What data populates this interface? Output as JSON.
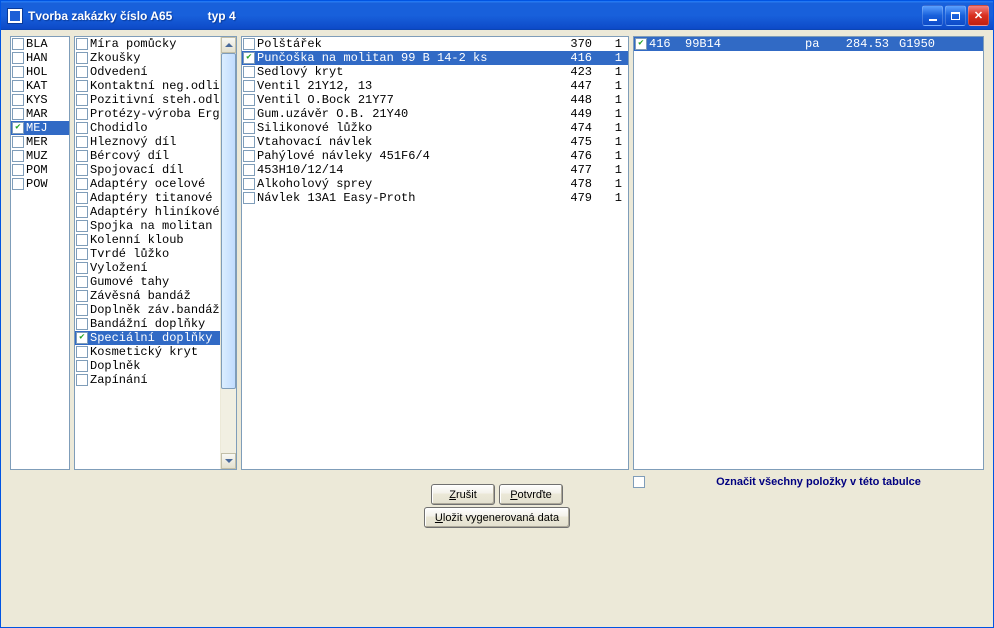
{
  "window": {
    "title_main": "Tvorba zakázky číslo A65",
    "title_typ": "typ 4"
  },
  "list1": {
    "items": [
      {
        "label": "BLA",
        "checked": false,
        "selected": false
      },
      {
        "label": "HAN",
        "checked": false,
        "selected": false
      },
      {
        "label": "HOL",
        "checked": false,
        "selected": false
      },
      {
        "label": "KAT",
        "checked": false,
        "selected": false
      },
      {
        "label": "KYS",
        "checked": false,
        "selected": false
      },
      {
        "label": "MAR",
        "checked": false,
        "selected": false
      },
      {
        "label": "MEJ",
        "checked": true,
        "selected": true
      },
      {
        "label": "MER",
        "checked": false,
        "selected": false
      },
      {
        "label": "MUZ",
        "checked": false,
        "selected": false
      },
      {
        "label": "POM",
        "checked": false,
        "selected": false
      },
      {
        "label": "POW",
        "checked": false,
        "selected": false
      }
    ]
  },
  "list2": {
    "items": [
      {
        "label": "Míra pomůcky",
        "checked": false,
        "selected": false
      },
      {
        "label": "Zkoušky",
        "checked": false,
        "selected": false
      },
      {
        "label": "Odvedení",
        "checked": false,
        "selected": false
      },
      {
        "label": "Kontaktní neg.odlit",
        "checked": false,
        "selected": false
      },
      {
        "label": "Pozitivní steh.odlit",
        "checked": false,
        "selected": false
      },
      {
        "label": "Protézy-výroba Ergon",
        "checked": false,
        "selected": false
      },
      {
        "label": "Chodidlo",
        "checked": false,
        "selected": false
      },
      {
        "label": "Hleznový díl",
        "checked": false,
        "selected": false
      },
      {
        "label": "Bércový díl",
        "checked": false,
        "selected": false
      },
      {
        "label": "Spojovací díl",
        "checked": false,
        "selected": false
      },
      {
        "label": "Adaptéry ocelové",
        "checked": false,
        "selected": false
      },
      {
        "label": "Adaptéry titanové",
        "checked": false,
        "selected": false
      },
      {
        "label": "Adaptéry hliníkové",
        "checked": false,
        "selected": false
      },
      {
        "label": "Spojka na molitan",
        "checked": false,
        "selected": false
      },
      {
        "label": "Kolenní kloub",
        "checked": false,
        "selected": false
      },
      {
        "label": "Tvrdé lůžko",
        "checked": false,
        "selected": false
      },
      {
        "label": "Vyložení",
        "checked": false,
        "selected": false
      },
      {
        "label": "Gumové tahy",
        "checked": false,
        "selected": false
      },
      {
        "label": "Závěsná bandáž",
        "checked": false,
        "selected": false
      },
      {
        "label": "Doplněk záv.bandáže",
        "checked": false,
        "selected": false
      },
      {
        "label": "Bandážní doplňky",
        "checked": false,
        "selected": false
      },
      {
        "label": "Speciální doplňky",
        "checked": true,
        "selected": true
      },
      {
        "label": "Kosmetický kryt",
        "checked": false,
        "selected": false
      },
      {
        "label": "Doplněk",
        "checked": false,
        "selected": false
      },
      {
        "label": "Zapínání",
        "checked": false,
        "selected": false
      }
    ]
  },
  "list3": {
    "items": [
      {
        "label": "Polštářek",
        "num1": "370",
        "num2": "1",
        "checked": false,
        "selected": false
      },
      {
        "label": "Punčoška na molitan 99 B 14-2 ks",
        "num1": "416",
        "num2": "1",
        "checked": true,
        "selected": true
      },
      {
        "label": "Sedlový kryt",
        "num1": "423",
        "num2": "1",
        "checked": false,
        "selected": false
      },
      {
        "label": "Ventil 21Y12, 13",
        "num1": "447",
        "num2": "1",
        "checked": false,
        "selected": false
      },
      {
        "label": "Ventil O.Bock 21Y77",
        "num1": "448",
        "num2": "1",
        "checked": false,
        "selected": false
      },
      {
        "label": "Gum.uzávěr O.B. 21Y40",
        "num1": "449",
        "num2": "1",
        "checked": false,
        "selected": false
      },
      {
        "label": "Silikonové lůžko",
        "num1": "474",
        "num2": "1",
        "checked": false,
        "selected": false
      },
      {
        "label": "Vtahovací návlek",
        "num1": "475",
        "num2": "1",
        "checked": false,
        "selected": false
      },
      {
        "label": "Pahýlové návleky 451F6/4",
        "num1": "476",
        "num2": "1",
        "checked": false,
        "selected": false
      },
      {
        "label": "453H10/12/14",
        "num1": "477",
        "num2": "1",
        "checked": false,
        "selected": false
      },
      {
        "label": "Alkoholový sprey",
        "num1": "478",
        "num2": "1",
        "checked": false,
        "selected": false
      },
      {
        "label": "Návlek 13A1 Easy-Proth",
        "num1": "479",
        "num2": "1",
        "checked": false,
        "selected": false
      }
    ]
  },
  "list4": {
    "items": [
      {
        "c1": "416",
        "c2": "99B14",
        "c3": "pa",
        "c4": "284.53",
        "c5": "G1950",
        "checked": true,
        "selected": true
      }
    ]
  },
  "helper": {
    "label": "Označit všechny položky v této tabulce"
  },
  "buttons": {
    "cancel": "Zrušit",
    "cancel_u": "Z",
    "cancel_rest": "rušit",
    "confirm": "Potvrďte",
    "confirm_u": "P",
    "confirm_rest": "otvrďte",
    "save": "Uložit vygenerovaná data",
    "save_u": "U",
    "save_rest": "ložit vygenerovaná data"
  }
}
